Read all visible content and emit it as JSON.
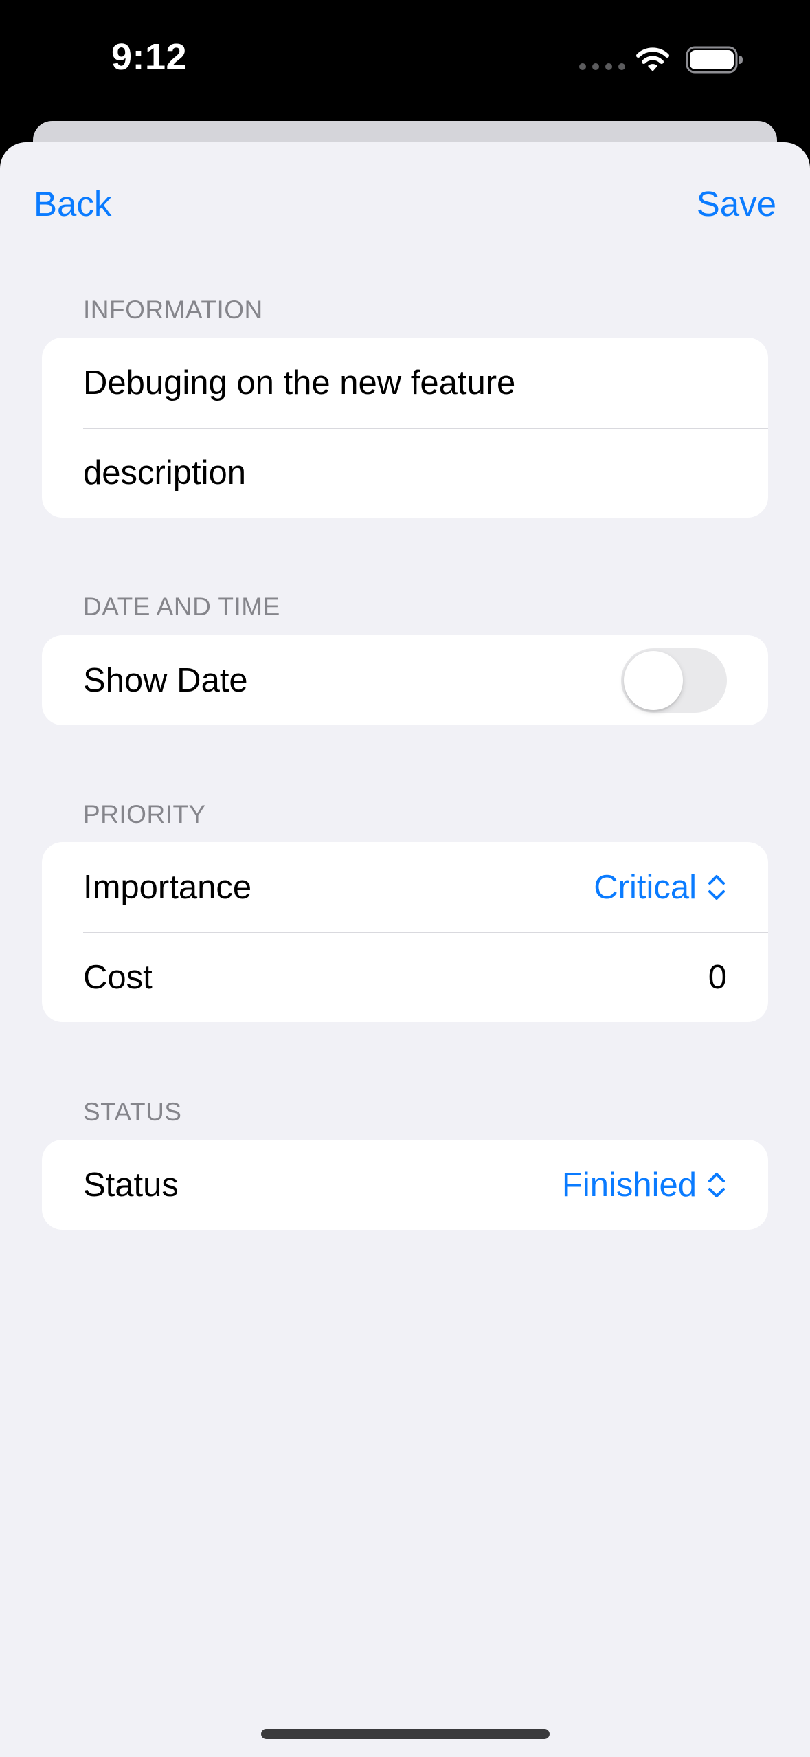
{
  "status_bar": {
    "time": "9:12",
    "icons": [
      "cellular-signal-icon",
      "wifi-icon",
      "battery-icon"
    ]
  },
  "nav": {
    "back_label": "Back",
    "save_label": "Save"
  },
  "sections": {
    "information": {
      "header": "INFORMATION",
      "title_value": "Debuging on the new feature",
      "description_value": "description"
    },
    "date_time": {
      "header": "DATE AND TIME",
      "show_date_label": "Show Date",
      "show_date_on": false
    },
    "priority": {
      "header": "PRIORITY",
      "importance_label": "Importance",
      "importance_value": "Critical",
      "cost_label": "Cost",
      "cost_value": "0"
    },
    "status": {
      "header": "STATUS",
      "status_label": "Status",
      "status_value": "Finishied"
    }
  },
  "colors": {
    "accent": "#0a7bff",
    "background": "#f1f1f6",
    "card": "#ffffff",
    "secondary_text": "#85858b"
  }
}
